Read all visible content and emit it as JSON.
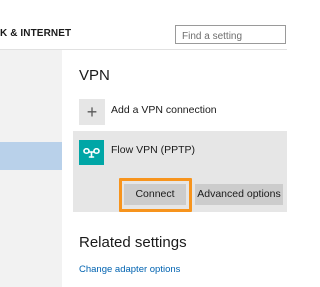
{
  "header": {
    "section_title": "K & INTERNET",
    "search_placeholder": "Find a setting"
  },
  "vpn": {
    "heading": "VPN",
    "add_connection_label": "Add a VPN connection",
    "add_icon_symbol": "+",
    "connection": {
      "name": "Flow VPN (PPTP)",
      "icon": "vpn-link-icon",
      "icon_color": "#00a6a6",
      "connect_label": "Connect",
      "advanced_label": "Advanced options"
    }
  },
  "related": {
    "heading": "Related settings",
    "link_label": "Change adapter options"
  },
  "colors": {
    "accent_highlight": "#f7941d",
    "link": "#0063b1",
    "sidebar_selected": "#b9d1ea"
  }
}
